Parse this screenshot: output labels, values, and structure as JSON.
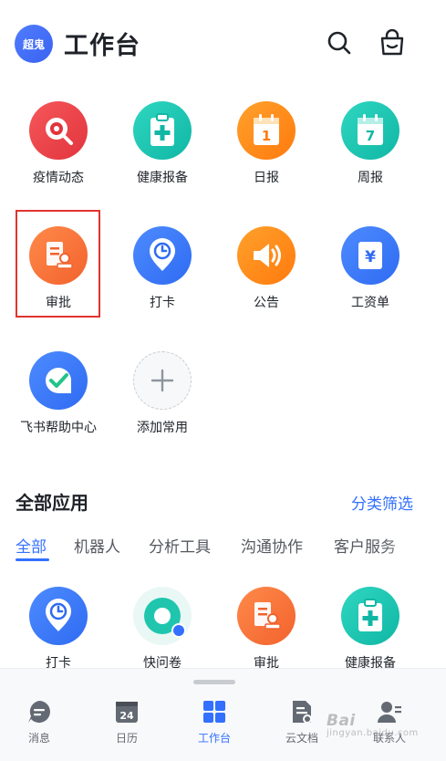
{
  "header": {
    "avatar_text": "超鬼",
    "title": "工作台"
  },
  "colors": {
    "accent": "#3370ff",
    "highlight_box": "#e0342e"
  },
  "grid": [
    {
      "label": "疫情动态",
      "icon": "virus-icon"
    },
    {
      "label": "健康报备",
      "icon": "medical-clipboard-icon"
    },
    {
      "label": "日报",
      "icon": "calendar-1-icon"
    },
    {
      "label": "周报",
      "icon": "calendar-7-icon"
    },
    {
      "label": "审批",
      "icon": "approval-icon"
    },
    {
      "label": "打卡",
      "icon": "clock-pin-icon"
    },
    {
      "label": "公告",
      "icon": "speaker-icon"
    },
    {
      "label": "工资单",
      "icon": "yen-card-icon"
    },
    {
      "label": "飞书帮助中心",
      "icon": "help-check-icon"
    },
    {
      "label": "添加常用",
      "icon": "plus-icon"
    }
  ],
  "section": {
    "title": "全部应用",
    "filter_label": "分类筛选"
  },
  "tabs": [
    {
      "label": "全部"
    },
    {
      "label": "机器人"
    },
    {
      "label": "分析工具"
    },
    {
      "label": "沟通协作"
    },
    {
      "label": "客户服务"
    }
  ],
  "apps": [
    {
      "label": "打卡",
      "icon": "clock-pin-icon"
    },
    {
      "label": "快问卷",
      "icon": "survey-icon"
    },
    {
      "label": "审批",
      "icon": "approval-icon"
    },
    {
      "label": "健康报备",
      "icon": "medical-clipboard-icon"
    }
  ],
  "bottom_nav": [
    {
      "label": "消息",
      "icon": "chat-icon"
    },
    {
      "label": "日历",
      "icon": "calendar-icon",
      "date_text": "24"
    },
    {
      "label": "工作台",
      "icon": "grid-icon"
    },
    {
      "label": "云文档",
      "icon": "document-icon"
    },
    {
      "label": "联系人",
      "icon": "contacts-icon"
    }
  ],
  "watermark": {
    "text": "Bai",
    "sub": "jingyan.baidu.com"
  }
}
